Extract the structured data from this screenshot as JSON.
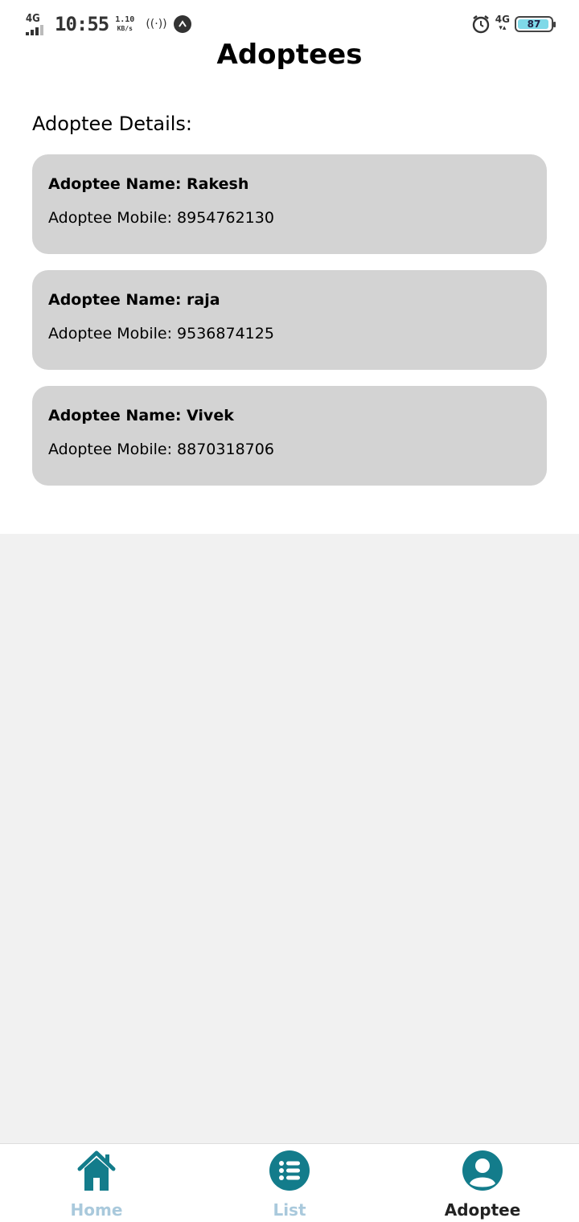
{
  "status_bar": {
    "network": "4G",
    "time": "10:55",
    "speed_value": "1.10",
    "speed_unit": "KB/s",
    "network_right": "4G",
    "battery": "87"
  },
  "header": {
    "title": "Adoptees"
  },
  "section": {
    "title": "Adoptee Details:"
  },
  "adoptees": [
    {
      "name": "Adoptee Name: Rakesh",
      "mobile": "Adoptee Mobile: 8954762130"
    },
    {
      "name": "Adoptee Name: raja",
      "mobile": "Adoptee Mobile: 9536874125"
    },
    {
      "name": "Adoptee Name: Vivek",
      "mobile": "Adoptee Mobile: 8870318706"
    }
  ],
  "bottom_nav": {
    "items": [
      {
        "label": "Home",
        "icon": "home-icon",
        "active": false
      },
      {
        "label": "List",
        "icon": "list-icon",
        "active": false
      },
      {
        "label": "Adoptee",
        "icon": "user-circle-icon",
        "active": true
      }
    ]
  },
  "colors": {
    "accent": "#137c8b",
    "card_bg": "#d3d3d3",
    "inactive_label": "#a9c9dc",
    "page_bg": "#f1f1f1"
  }
}
